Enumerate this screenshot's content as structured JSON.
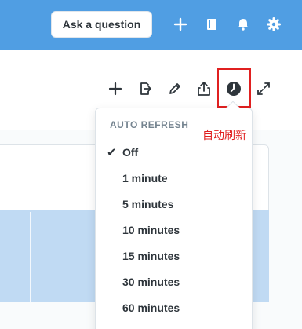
{
  "header": {
    "ask_label": "Ask a question",
    "icons": [
      "plus-icon",
      "notebook-icon",
      "bell-icon",
      "gear-icon"
    ],
    "color": "#509ee3"
  },
  "toolbar": {
    "icons": [
      "plus-icon",
      "move-icon",
      "pencil-icon",
      "share-icon",
      "clock-icon",
      "fullscreen-icon"
    ]
  },
  "auto_refresh": {
    "title": "AUTO REFRESH",
    "selected": "Off",
    "options": [
      "Off",
      "1 minute",
      "5 minutes",
      "10 minutes",
      "15 minutes",
      "30 minutes",
      "60 minutes"
    ]
  },
  "annotation": {
    "text": "自动刷新",
    "color": "#e02020"
  }
}
